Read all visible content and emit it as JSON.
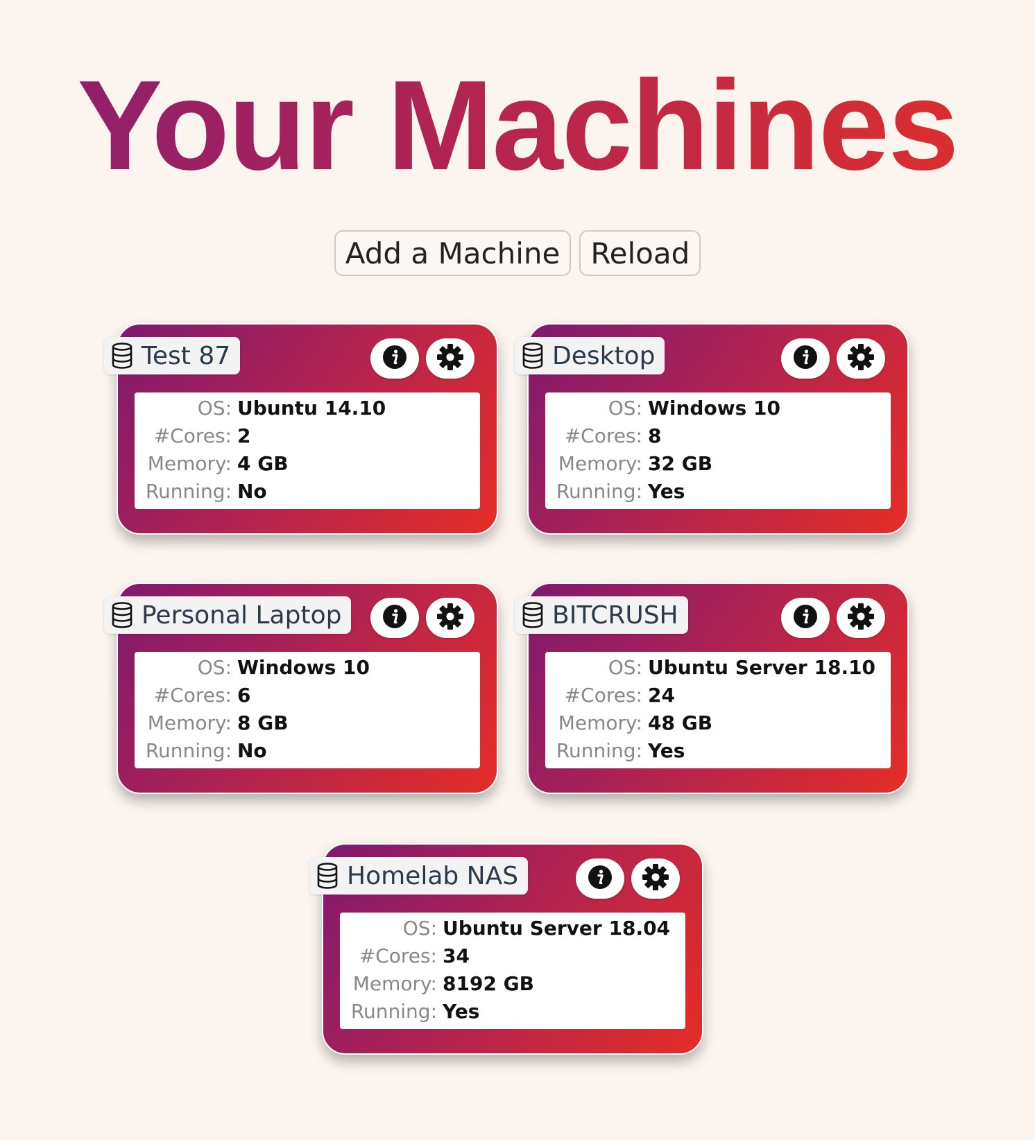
{
  "header": {
    "title": "Your Machines"
  },
  "toolbar": {
    "add_label": "Add a Machine",
    "reload_label": "Reload"
  },
  "labels": {
    "os": "OS:",
    "cores": "#Cores:",
    "memory": "Memory:",
    "running": "Running:"
  },
  "colors": {
    "background": "#fcf4ef",
    "card_gradient_start": "#80196e",
    "card_gradient_end": "#e52e26"
  },
  "icons": {
    "name_tag": "database-icon",
    "info": "info-icon",
    "settings": "gear-icon"
  },
  "machines": [
    {
      "name": "Test 87",
      "os": "Ubuntu 14.10",
      "cores": "2",
      "memory": "4 GB",
      "running": "No"
    },
    {
      "name": "Desktop",
      "os": "Windows 10",
      "cores": "8",
      "memory": "32 GB",
      "running": "Yes"
    },
    {
      "name": "Personal Laptop",
      "os": "Windows 10",
      "cores": "6",
      "memory": "8 GB",
      "running": "No"
    },
    {
      "name": "BITCRUSH",
      "os": "Ubuntu Server 18.10",
      "cores": "24",
      "memory": "48 GB",
      "running": "Yes"
    },
    {
      "name": "Homelab NAS",
      "os": "Ubuntu Server 18.04",
      "cores": "34",
      "memory": "8192 GB",
      "running": "Yes"
    }
  ]
}
